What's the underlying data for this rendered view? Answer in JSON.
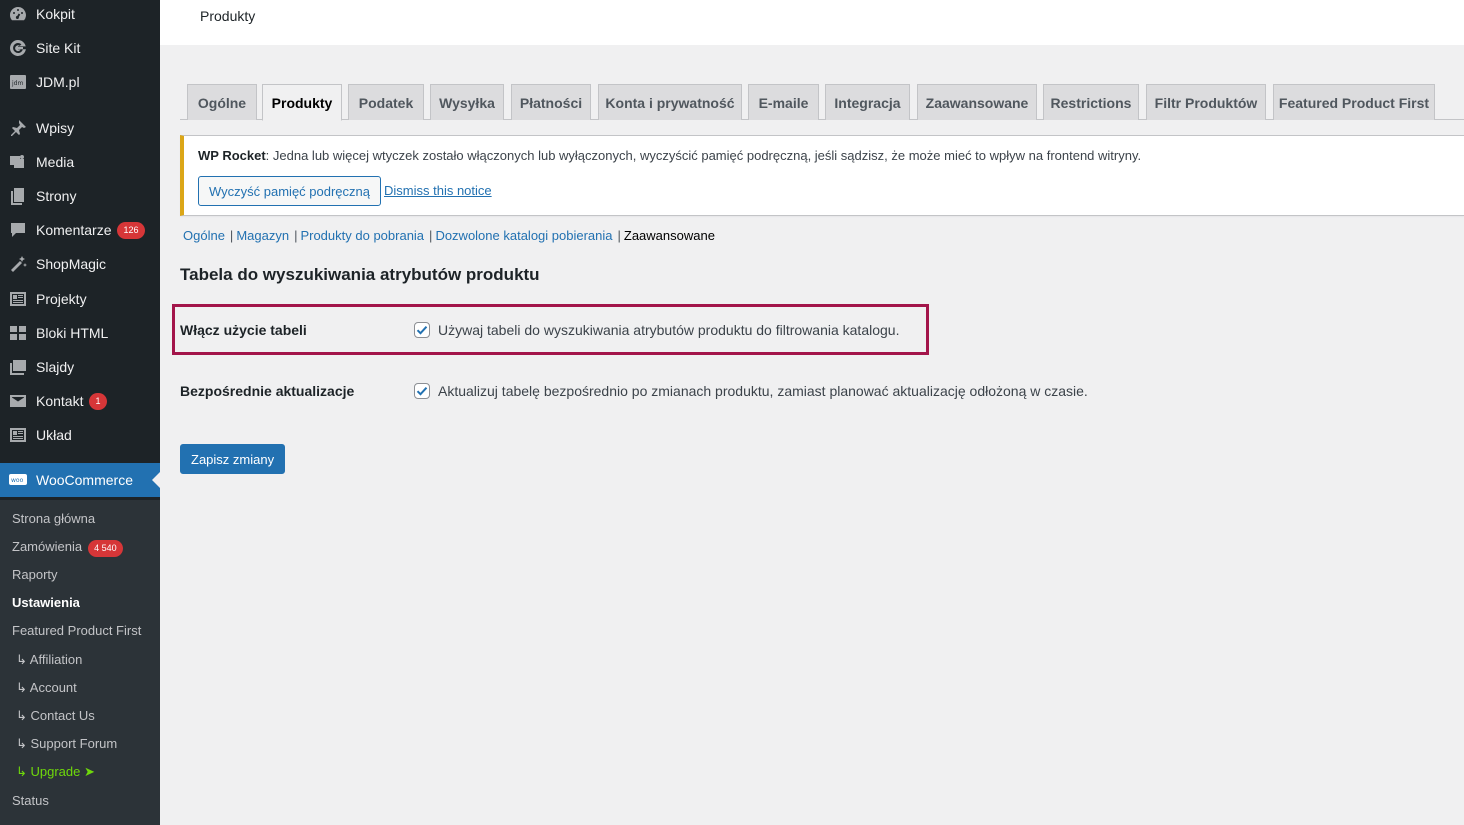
{
  "sidebar": {
    "items": [
      {
        "label": "Kokpit",
        "icon": "dashboard-icon"
      },
      {
        "label": "Site Kit",
        "icon": "google-g-icon"
      },
      {
        "label": "JDM.pl",
        "icon": "jdm-icon"
      },
      {
        "label": "Wpisy",
        "icon": "pin-icon"
      },
      {
        "label": "Media",
        "icon": "media-icon"
      },
      {
        "label": "Strony",
        "icon": "pages-icon"
      },
      {
        "label": "Komentarze",
        "icon": "comment-icon",
        "badge": "126"
      },
      {
        "label": "ShopMagic",
        "icon": "magic-wand-icon"
      },
      {
        "label": "Projekty",
        "icon": "portfolio-icon"
      },
      {
        "label": "Bloki HTML",
        "icon": "grid-icon"
      },
      {
        "label": "Slajdy",
        "icon": "slides-icon"
      },
      {
        "label": "Kontakt",
        "icon": "mail-icon",
        "badge": "1"
      },
      {
        "label": "Układ",
        "icon": "layout-icon"
      },
      {
        "label": "WooCommerce",
        "icon": "woo-icon"
      }
    ],
    "submenu": [
      {
        "label": "Strona główna"
      },
      {
        "label": "Zamówienia",
        "badge": "4 540"
      },
      {
        "label": "Raporty"
      },
      {
        "label": "Ustawienia"
      },
      {
        "label": "Featured Product First"
      },
      {
        "label": "↳ Affiliation"
      },
      {
        "label": "↳ Account"
      },
      {
        "label": "↳ Contact Us"
      },
      {
        "label": "↳ Support Forum"
      },
      {
        "label": "↳ Upgrade ➤"
      },
      {
        "label": "Status"
      }
    ]
  },
  "header": {
    "title": "Produkty"
  },
  "tabs": [
    "Ogólne",
    "Produkty",
    "Podatek",
    "Wysyłka",
    "Płatności",
    "Konta i prywatność",
    "E-maile",
    "Integracja",
    "Zaawansowane",
    "Restrictions",
    "Filtr Produktów",
    "Featured Product First"
  ],
  "notice": {
    "prefix": "WP Rocket",
    "text": ": Jedna lub więcej wtyczek zostało włączonych lub wyłączonych, wyczyścić pamięć podręczną, jeśli sądzisz, że może mieć to wpływ na frontend witryny.",
    "button": "Wyczyść pamięć podręczną",
    "dismiss": "Dismiss this notice"
  },
  "subnav": {
    "links": [
      "Ogólne",
      "Magazyn",
      "Produkty do pobrania",
      "Dozwolone katalogi pobierania"
    ],
    "current": "Zaawansowane"
  },
  "section": {
    "title": "Tabela do wyszukiwania atrybutów produktu",
    "rows": [
      {
        "label": "Włącz użycie tabeli",
        "checkbox_label": "Używaj tabeli do wyszukiwania atrybutów produktu do filtrowania katalogu.",
        "checked": true
      },
      {
        "label": "Bezpośrednie aktualizacje",
        "checkbox_label": "Aktualizuj tabelę bezpośrednio po zmianach produktu, zamiast planować aktualizację odłożoną w czasie.",
        "checked": true
      }
    ]
  },
  "save_button": "Zapisz zmiany",
  "colors": {
    "accent": "#2271b1",
    "sidebar": "#1d2327",
    "highlight": "#a3154a",
    "notice_warning": "#dba617"
  }
}
